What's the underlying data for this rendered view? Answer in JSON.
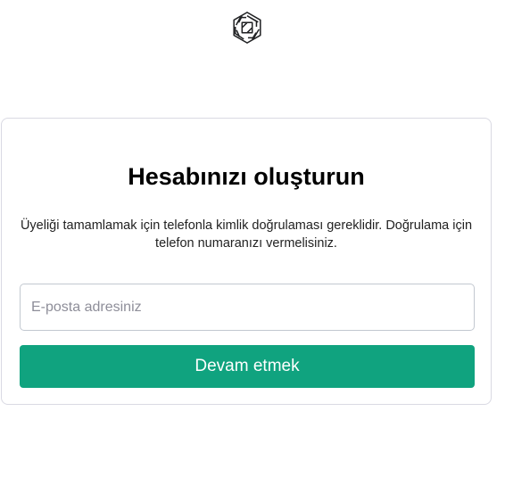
{
  "logo": {
    "icon": "openai-logo-icon",
    "color": "#202123"
  },
  "signup": {
    "title": "Hesabınızı oluşturun",
    "description_line1": "Üyeliği tamamlamak için telefonla kimlik doğrulaması gereklidir. Doğrulama için",
    "description_line2": "telefon numaranızı vermelisiniz.",
    "email_value": "",
    "email_placeholder": "E-posta adresiniz",
    "continue_label": "Devam etmek"
  },
  "colors": {
    "accent": "#10a37f",
    "card_border": "#d9d9e3",
    "input_border": "#c2c8d0",
    "placeholder": "#8e8e99"
  }
}
